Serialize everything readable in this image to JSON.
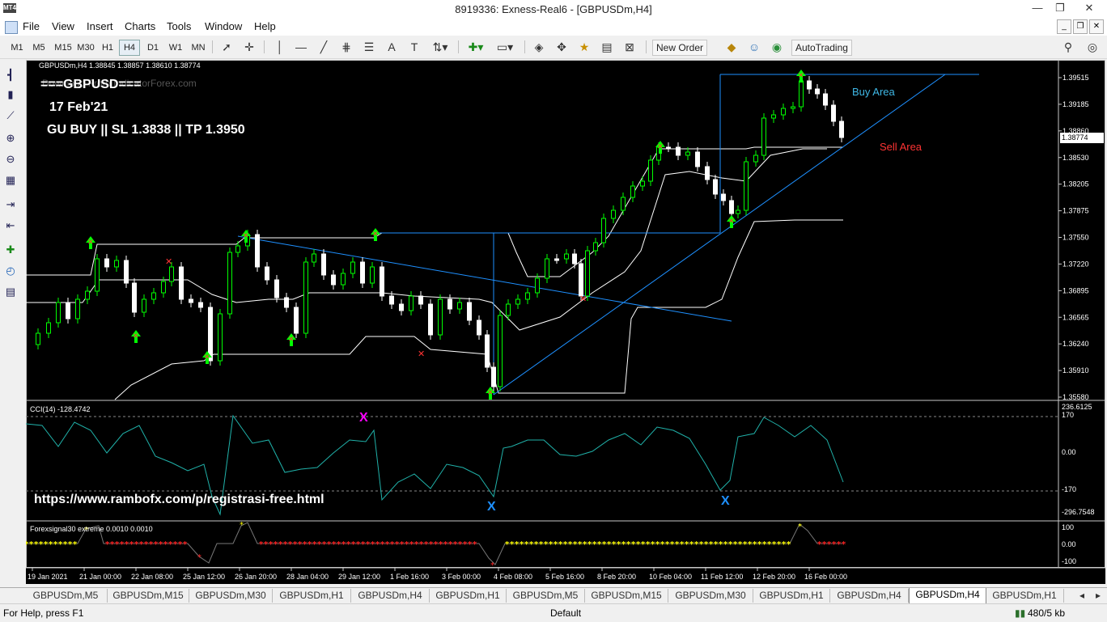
{
  "window": {
    "title": "8919336: Exness-Real6 - [GBPUSDm,H4]",
    "app_logo": "MT4",
    "minimize_glyph": "—",
    "restore_glyph": "❐",
    "close_glyph": "✕"
  },
  "menu": [
    "File",
    "View",
    "Insert",
    "Charts",
    "Tools",
    "Window",
    "Help"
  ],
  "toolbar": {
    "timeframes": [
      "M1",
      "M5",
      "M15",
      "M30",
      "H1",
      "H4",
      "D1",
      "W1",
      "MN"
    ],
    "active_timeframe": "H4",
    "new_order": "New Order",
    "autotrading": "AutoTrading"
  },
  "chart": {
    "symbol_info": "GBPUSDm,H4  1.38845 1.38857 1.38610 1.38774",
    "watermark": "Download From IndicatorForex.com",
    "overlay": {
      "title": "===GBPUSD===",
      "date": "17 Feb'21",
      "signal": "GU BUY || SL 1.3838  || TP 1.3950",
      "buy_area": "Buy Area",
      "sell_area": "Sell Area",
      "url": "https://www.rambofx.com/p/registrasi-free.html"
    },
    "current_price": "1.38774",
    "price_labels": [
      "1.39515",
      "1.39185",
      "1.38860",
      "1.38530",
      "1.38205",
      "1.37875",
      "1.37550",
      "1.37220",
      "1.36895",
      "1.36565",
      "1.36240",
      "1.35910",
      "1.35580"
    ],
    "time_labels": [
      "19 Jan 2021",
      "21 Jan 00:00",
      "22 Jan 08:00",
      "25 Jan 12:00",
      "26 Jan 20:00",
      "28 Jan 04:00",
      "29 Jan 12:00",
      "1 Feb 16:00",
      "3 Feb 00:00",
      "4 Feb 08:00",
      "5 Feb 16:00",
      "8 Feb 20:00",
      "10 Feb 04:00",
      "11 Feb 12:00",
      "12 Feb 20:00",
      "16 Feb 00:00"
    ],
    "cci": {
      "label": "CCI(14) -128.4742",
      "levels": [
        "236.6125",
        "170",
        "0.00",
        "-170",
        "-296.7548"
      ],
      "x_marks": [
        "X",
        "X",
        "X"
      ]
    },
    "fsig": {
      "label": "Forexsignal30 extreme 0.0010 0.0010",
      "levels": [
        "100",
        "0.00",
        "-100"
      ]
    },
    "colors": {
      "bull": "#00ff00",
      "bear": "#ffffff",
      "trendline": "#1e90ff",
      "channel": "#ffffff",
      "buy_area": "#3fb8e6",
      "sell_area": "#ff3333",
      "cci_line": "#20b2aa",
      "sig_yellow": "#ffff00",
      "sig_red": "#ff2020"
    }
  },
  "tabs": [
    "GBPUSDm,M5",
    "GBPUSDm,M15",
    "GBPUSDm,M30",
    "GBPUSDm,H1",
    "GBPUSDm,H4",
    "GBPUSDm,H1",
    "GBPUSDm,M5",
    "GBPUSDm,M15",
    "GBPUSDm,M30",
    "GBPUSDm,H1",
    "GBPUSDm,H4",
    "GBPUSDm,H4",
    "GBPUSDm,H1"
  ],
  "active_tab_index": 11,
  "status": {
    "help": "For Help, press F1",
    "profile": "Default",
    "traffic": "480/5 kb"
  }
}
